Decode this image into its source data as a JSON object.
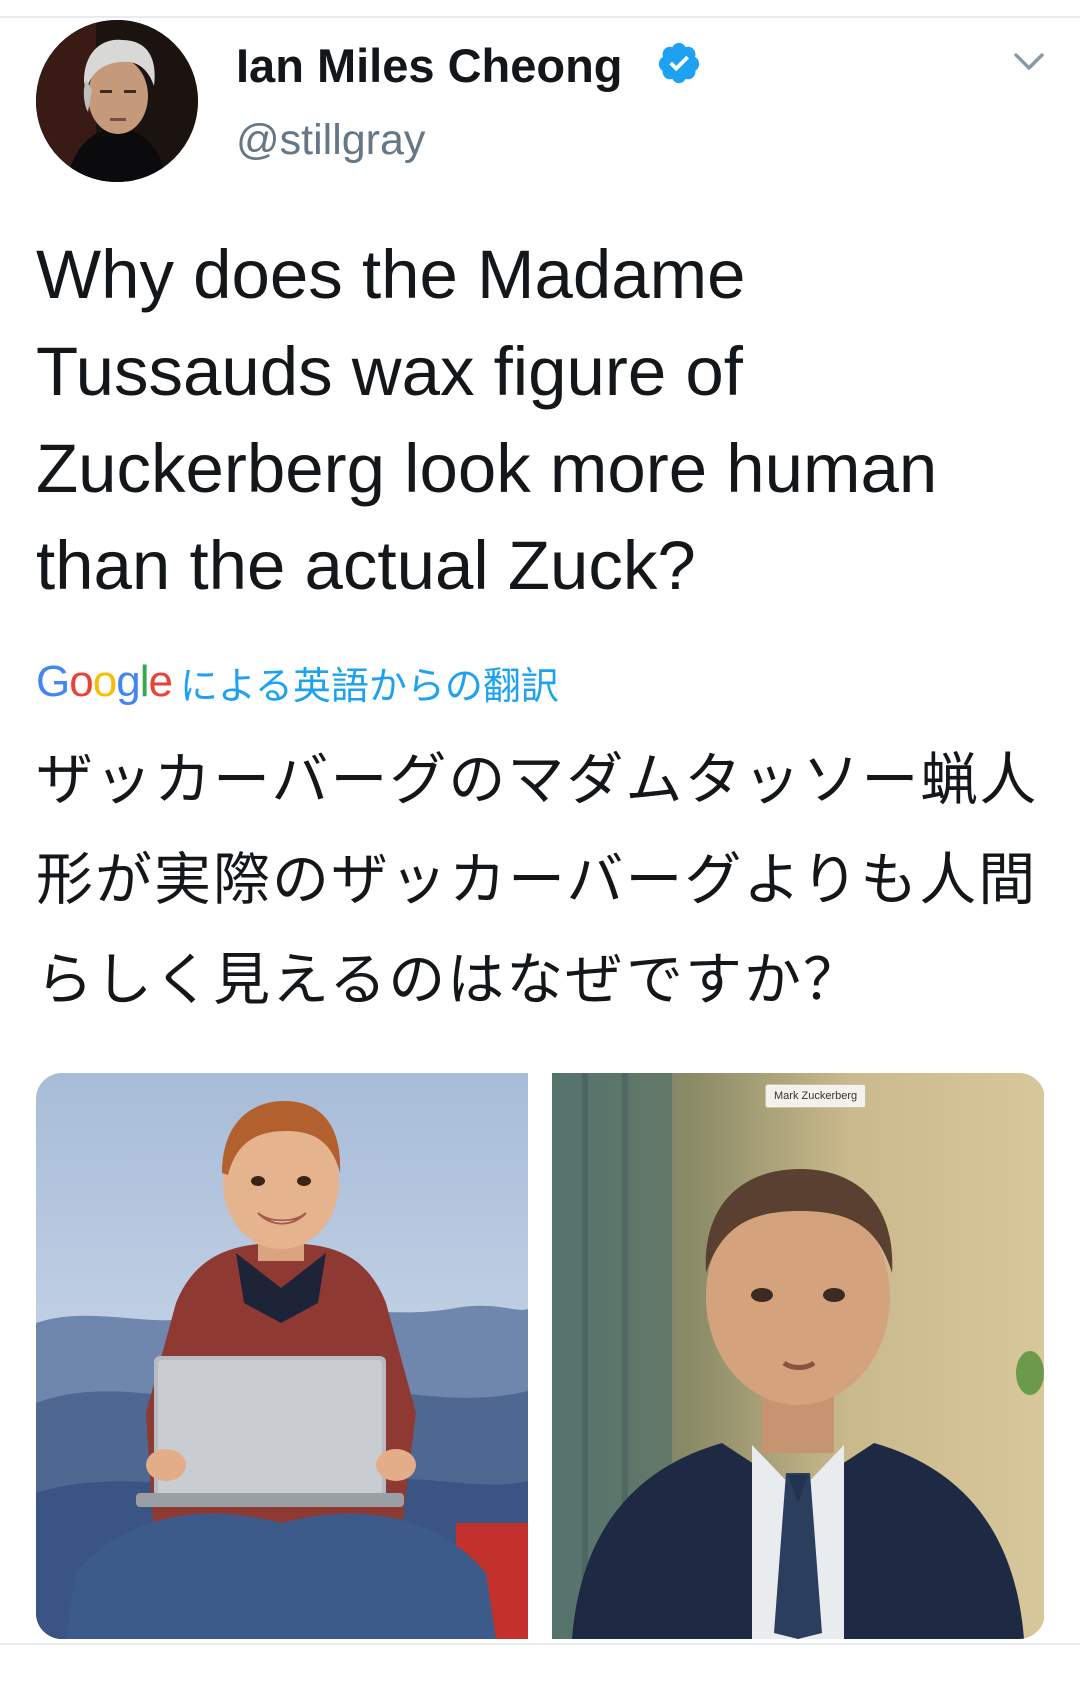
{
  "tweet": {
    "author": {
      "name": "Ian Miles Cheong",
      "handle": "@stillgray",
      "verified": true,
      "verified_color": "#1da1f2"
    },
    "text": "Why does the Madame Tussauds wax figure of Zuckerberg look more human than the actual Zuck?",
    "translation": {
      "provider_logo": "Google",
      "label": "による英語からの翻訳",
      "text": "ザッカーバーグのマダムタッソー蝋人形が実際のザッカーバーグよりも人間らしく見えるのはなぜですか？"
    },
    "media": [
      {
        "icon": "wax-figure-photo"
      },
      {
        "icon": "video-call-photo",
        "name_tag": "Mark Zuckerberg"
      }
    ],
    "more_icon": "chevron-down-icon"
  },
  "colors": {
    "text": "#14171a",
    "secondary": "#657786",
    "link": "#1da1f2",
    "divider": "#e6ecf0"
  }
}
